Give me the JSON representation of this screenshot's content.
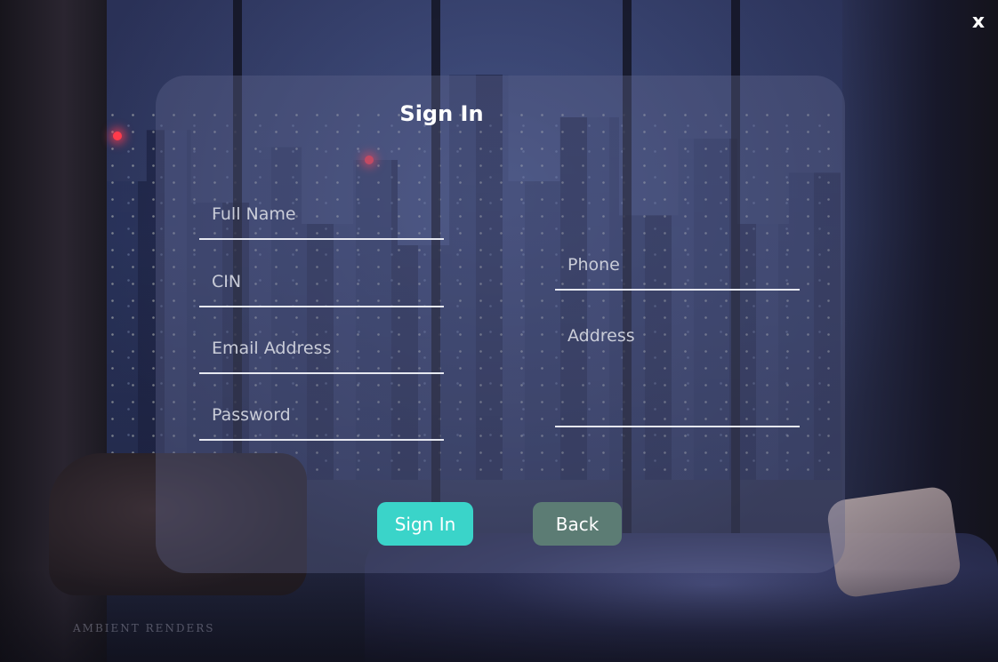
{
  "window": {
    "close_label": "x"
  },
  "form": {
    "title": "Sign In",
    "fields": {
      "full_name": {
        "placeholder": "Full Name",
        "value": ""
      },
      "cin": {
        "placeholder": "CIN",
        "value": ""
      },
      "email": {
        "placeholder": "Email Address",
        "value": ""
      },
      "password": {
        "placeholder": "Password",
        "value": ""
      },
      "phone": {
        "placeholder": "Phone",
        "value": ""
      },
      "address": {
        "placeholder": "Address",
        "value": ""
      }
    },
    "buttons": {
      "sign_in": "Sign In",
      "back": "Back"
    }
  },
  "background": {
    "watermark": "AMBIENT RENDERS"
  },
  "colors": {
    "sign_in_button": "#3ad4c9",
    "back_button": "#5c7c74",
    "field_underline": "#e6e8f0",
    "placeholder_text": "#c9ccd8",
    "title_text": "#ffffff"
  }
}
